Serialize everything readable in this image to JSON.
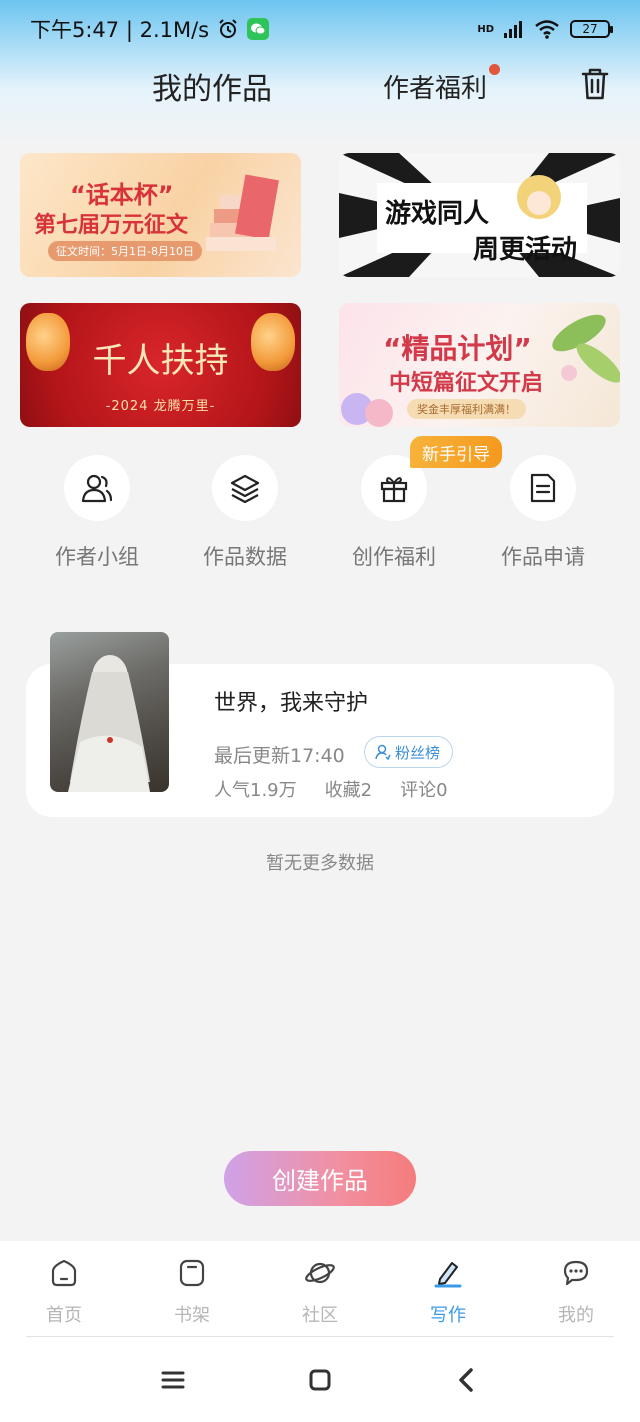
{
  "status_bar": {
    "time_speed": "下午5:47 | 2.1M/s",
    "network": "HD",
    "battery": "27"
  },
  "header": {
    "title": "我的作品",
    "author_benefit": "作者福利"
  },
  "banners": [
    {
      "title_line1": "“话本杯”",
      "title_line2": "第七届万元征文",
      "date": "征文时间：5月1日-8月10日"
    },
    {
      "title_line1": "游戏同人",
      "title_line2": "周更活动"
    },
    {
      "title": "千人扶持",
      "subtitle": "-2024 龙腾万里-"
    },
    {
      "title": "“精品计划”",
      "subtitle": "中短篇征文开启",
      "pill": "奖金丰厚福利满满！"
    }
  ],
  "quick_actions": [
    {
      "label": "作者小组",
      "icon": "people-icon"
    },
    {
      "label": "作品数据",
      "icon": "layers-icon"
    },
    {
      "label": "创作福利",
      "icon": "gift-icon"
    },
    {
      "label": "作品申请",
      "icon": "document-icon"
    }
  ],
  "guide_tag": "新手引导",
  "work": {
    "title": "世界，我来守护",
    "updated": "最后更新17:40",
    "fans_label": "粉丝榜",
    "popularity": "人气1.9万",
    "favorites": "收藏2",
    "comments": "评论0"
  },
  "no_more": "暂无更多数据",
  "create_button": "创建作品",
  "bottom_nav": [
    {
      "label": "首页",
      "icon": "home-icon"
    },
    {
      "label": "书架",
      "icon": "bookshelf-icon"
    },
    {
      "label": "社区",
      "icon": "planet-icon"
    },
    {
      "label": "写作",
      "icon": "pen-icon",
      "active": true
    },
    {
      "label": "我的",
      "icon": "chat-bubble-icon"
    }
  ],
  "colors": {
    "accent_blue": "#3b9be8",
    "notification_red": "#e2563b",
    "guide_orange": "#f5a52a"
  }
}
